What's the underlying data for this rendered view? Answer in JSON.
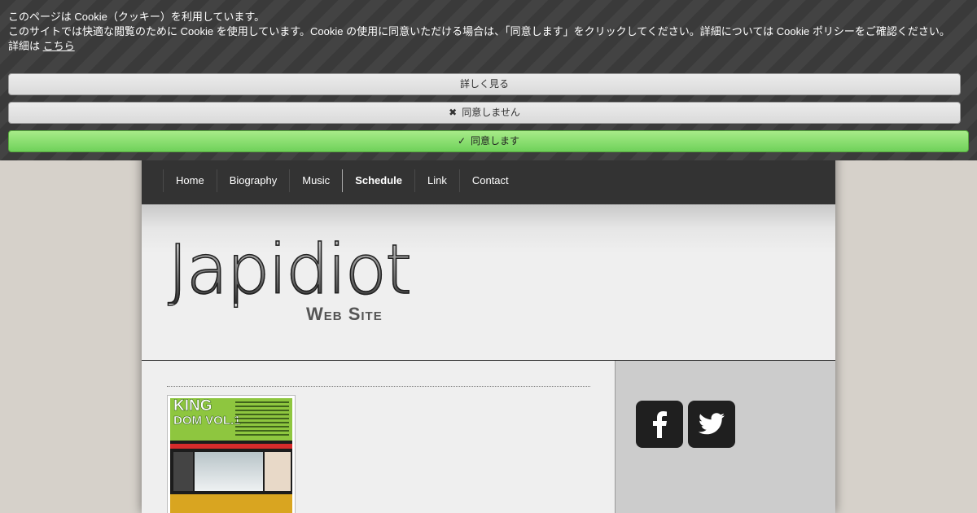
{
  "cookie_banner": {
    "title": "このページは Cookie（クッキー）を利用しています。",
    "description": "このサイトでは快適な閲覧のために Cookie を使用しています。Cookie の使用に同意いただける場合は、「同意します」をクリックしてください。詳細については Cookie ポリシーをご確認ください。",
    "details_prefix": "詳細は",
    "details_link": "こちら",
    "more_button": "詳しく見る",
    "decline_button": "同意しません",
    "accept_button": "同意します"
  },
  "nav": {
    "items": [
      {
        "label": "Home",
        "active": false
      },
      {
        "label": "Biography",
        "active": false
      },
      {
        "label": "Music",
        "active": false
      },
      {
        "label": "Schedule",
        "active": true
      },
      {
        "label": "Link",
        "active": false
      },
      {
        "label": "Contact",
        "active": false
      }
    ]
  },
  "header": {
    "logo_main": "Japidiot",
    "logo_sub": "Web Site"
  },
  "content": {
    "flyer_title_line1": "KING",
    "flyer_title_line2": "DOM VOL.1"
  },
  "sidebar": {
    "social": [
      {
        "icon": "facebook-icon"
      },
      {
        "icon": "twitter-icon"
      }
    ]
  },
  "colors": {
    "nav_bg": "#333333",
    "page_bg": "#d6d1ca",
    "accept_green": "#6fd15a",
    "sidebar_bg": "#cccccc"
  }
}
